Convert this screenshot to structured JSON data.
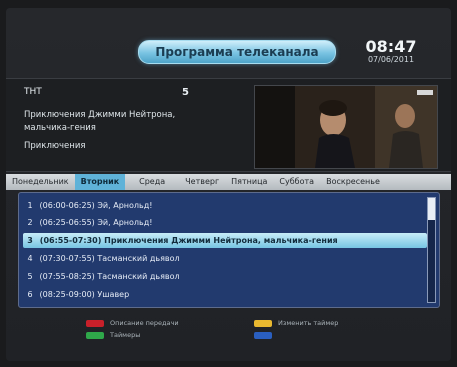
{
  "header": {
    "title": "Программа телеканала",
    "time": "08:47",
    "date": "07/06/2011"
  },
  "info": {
    "channel_name": "ТНТ",
    "channel_number": "5",
    "program_title": "Приключения Джимми Нейтрона, мальчика-гения",
    "genre": "Приключения"
  },
  "tabs": [
    {
      "label": "Понедельник",
      "active": false
    },
    {
      "label": "Вторник",
      "active": true
    },
    {
      "label": "Среда",
      "active": false
    },
    {
      "label": "Четверг",
      "active": false
    },
    {
      "label": "Пятница",
      "active": false
    },
    {
      "label": "Суббота",
      "active": false
    },
    {
      "label": "Воскресенье",
      "active": false
    }
  ],
  "programs": [
    {
      "num": "1",
      "time": "(06:00-06:25)",
      "title": "Эй, Арнольд!",
      "selected": false
    },
    {
      "num": "2",
      "time": "(06:25-06:55)",
      "title": "Эй, Арнольд!",
      "selected": false
    },
    {
      "num": "3",
      "time": "(06:55-07:30)",
      "title": "Приключения Джимми Нейтрона, мальчика-гения",
      "selected": true
    },
    {
      "num": "4",
      "time": "(07:30-07:55)",
      "title": "Тасманский дьявол",
      "selected": false
    },
    {
      "num": "5",
      "time": "(07:55-08:25)",
      "title": "Тасманский дьявол",
      "selected": false
    },
    {
      "num": "6",
      "time": "(08:25-09:00)",
      "title": "Ушавер",
      "selected": false
    }
  ],
  "legend": [
    {
      "color": "#c8202a",
      "label": "Описание передачи"
    },
    {
      "color": "#e8b830",
      "label": "Изменить таймер"
    },
    {
      "color": "#2fa84a",
      "label": "Таймеры"
    },
    {
      "color": "#2a5fc0",
      "label": ""
    }
  ]
}
